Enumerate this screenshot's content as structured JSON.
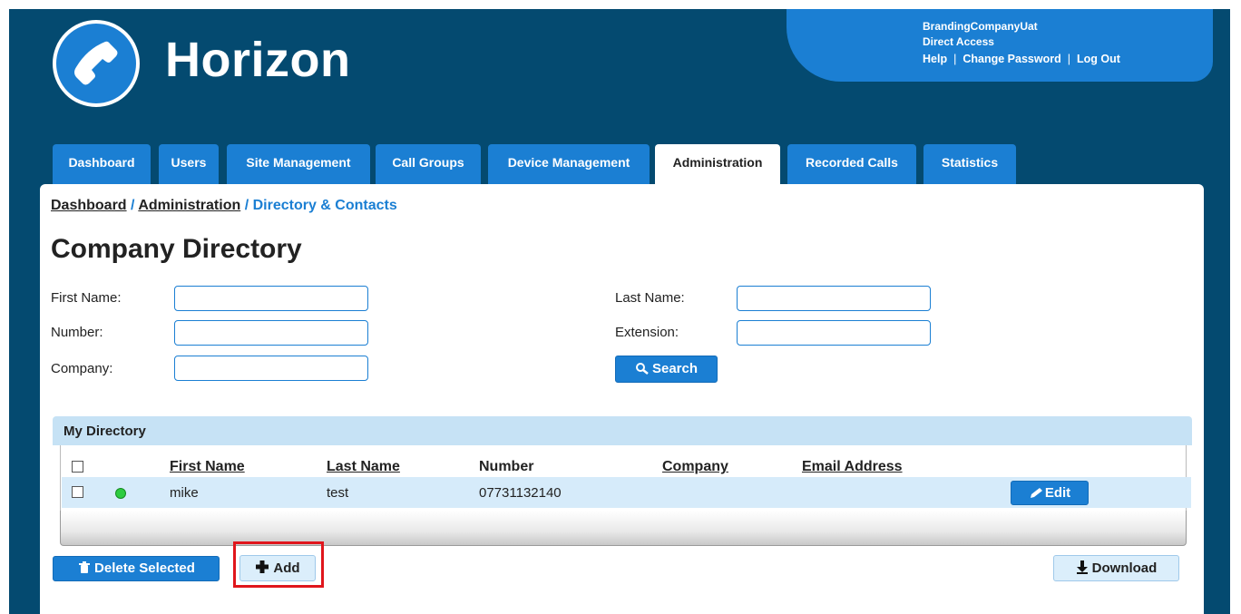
{
  "app": {
    "brand": "Horizon"
  },
  "account": {
    "company": "BrandingCompanyUat",
    "access": "Direct Access",
    "links": [
      "Help",
      "Change Password",
      "Log Out"
    ]
  },
  "tabs": [
    {
      "label": "Dashboard",
      "active": false
    },
    {
      "label": "Users",
      "active": false
    },
    {
      "label": "Site Management",
      "active": false
    },
    {
      "label": "Call Groups",
      "active": false
    },
    {
      "label": "Device Management",
      "active": false
    },
    {
      "label": "Administration",
      "active": true
    },
    {
      "label": "Recorded Calls",
      "active": false
    },
    {
      "label": "Statistics",
      "active": false
    }
  ],
  "breadcrumb": {
    "items": [
      "Dashboard",
      "Administration"
    ],
    "current": "Directory & Contacts",
    "separator": "/"
  },
  "page": {
    "title": "Company Directory"
  },
  "search_form": {
    "first_name": {
      "label": "First Name:",
      "value": ""
    },
    "last_name": {
      "label": "Last Name:",
      "value": ""
    },
    "number": {
      "label": "Number:",
      "value": ""
    },
    "extension": {
      "label": "Extension:",
      "value": ""
    },
    "company": {
      "label": "Company:",
      "value": ""
    },
    "search_button": "Search"
  },
  "directory": {
    "title": "My Directory",
    "columns": [
      "First Name",
      "Last Name",
      "Number",
      "Company",
      "Email Address"
    ],
    "rows": [
      {
        "first_name": "mike",
        "last_name": "test",
        "number": "07731132140",
        "company": "",
        "email": "",
        "status": "online"
      }
    ],
    "edit_label": "Edit"
  },
  "actions": {
    "delete_selected": "Delete Selected",
    "add": "Add",
    "download": "Download"
  },
  "colors": {
    "header_bg": "#044a70",
    "accent": "#1b7fd3",
    "row_highlight": "#d6ebfa",
    "status_online": "#2ecc40",
    "highlight_box": "#e0161c"
  }
}
